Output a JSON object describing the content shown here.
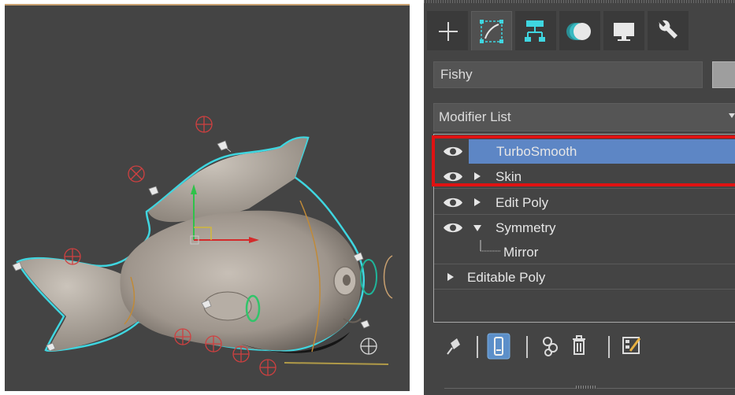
{
  "viewport": {
    "object_name": "Fishy",
    "gizmo": "transform-gizmo"
  },
  "command_panel": {
    "tabs": [
      {
        "name": "create-tab",
        "icon": "plus-icon",
        "active": false
      },
      {
        "name": "modify-tab",
        "icon": "modify-curve-icon",
        "active": true
      },
      {
        "name": "hierarchy-tab",
        "icon": "hierarchy-icon",
        "active": false
      },
      {
        "name": "motion-tab",
        "icon": "motion-icon",
        "active": false
      },
      {
        "name": "display-tab",
        "icon": "monitor-icon",
        "active": false
      },
      {
        "name": "utilities-tab",
        "icon": "wrench-icon",
        "active": false
      }
    ],
    "object_name": "Fishy",
    "modifier_list_label": "Modifier List",
    "stack": [
      {
        "label": "TurboSmooth",
        "eye": true,
        "expander": "none",
        "selected": true
      },
      {
        "label": "Skin",
        "eye": true,
        "expander": "collapsed",
        "selected": false
      },
      {
        "label": "Edit Poly",
        "eye": true,
        "expander": "collapsed",
        "selected": false
      },
      {
        "label": "Symmetry",
        "eye": true,
        "expander": "expanded",
        "selected": false
      },
      {
        "label": "Mirror",
        "eye": false,
        "expander": "sub-object",
        "selected": false
      },
      {
        "label": "Editable Poly",
        "eye": false,
        "expander": "collapsed",
        "selected": false
      }
    ],
    "toolbar": [
      {
        "name": "pin-stack-button",
        "icon": "pin-icon"
      },
      {
        "name": "show-end-result-button",
        "icon": "show-end-result-icon",
        "active": true
      },
      {
        "name": "make-unique-button",
        "icon": "make-unique-icon"
      },
      {
        "name": "remove-modifier-button",
        "icon": "trash-icon"
      },
      {
        "name": "configure-modifier-sets-button",
        "icon": "configure-sets-icon"
      }
    ],
    "colors": {
      "selection_highlight": "#5d86c5",
      "annotation_box": "#e01212",
      "panel_bg": "#444444",
      "selection_outline": "#3fd6e0"
    }
  }
}
